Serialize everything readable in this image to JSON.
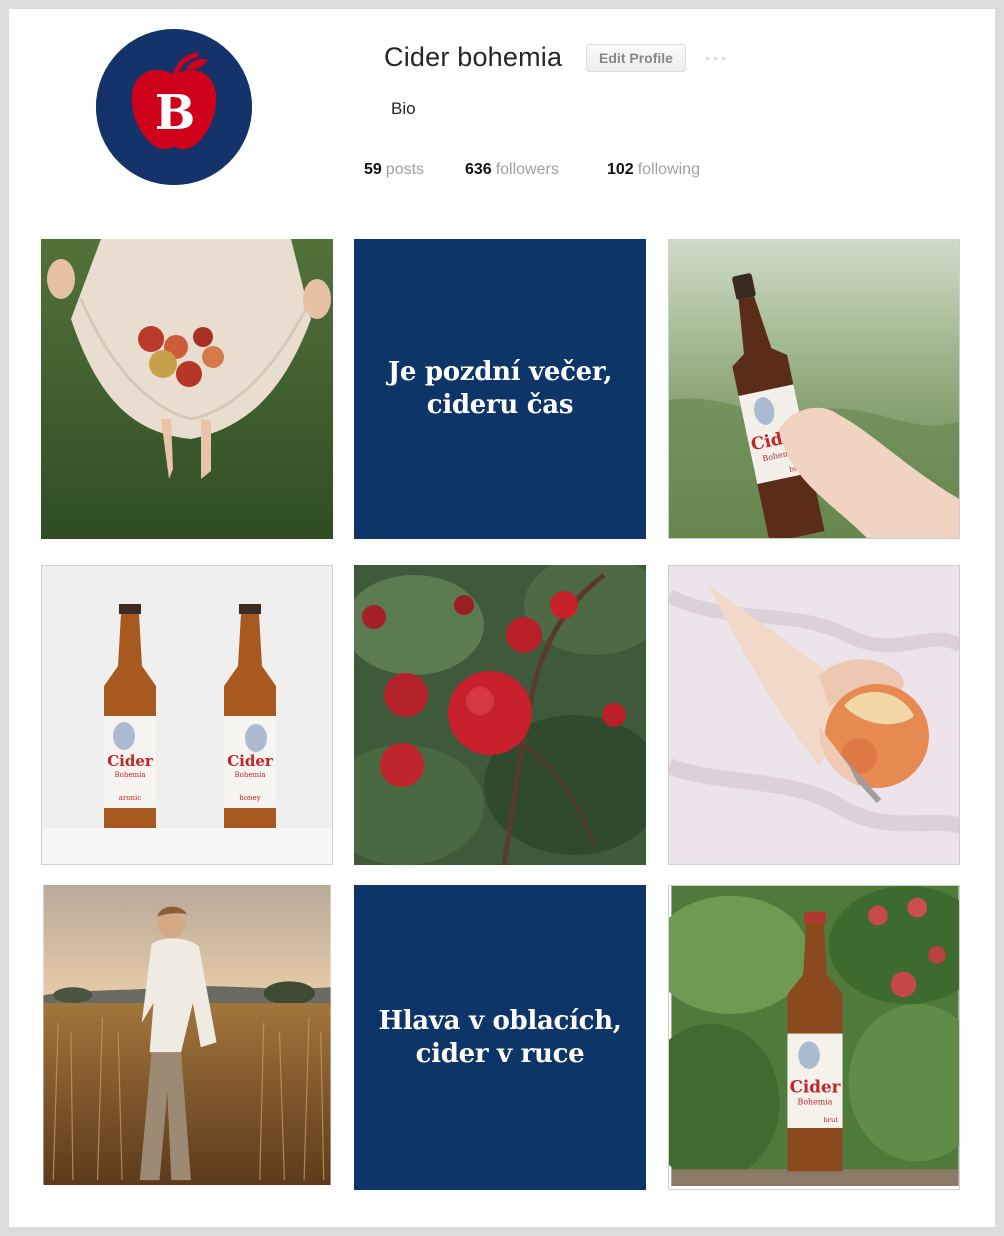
{
  "profile": {
    "username": "Cider bohemia",
    "edit_label": "Edit Profile",
    "bio": "Bio",
    "avatar_letter": "B",
    "brand_colors": {
      "navy": "#14336a",
      "red": "#d0021b"
    }
  },
  "stats": {
    "posts": {
      "count": "59",
      "label": "posts"
    },
    "followers": {
      "count": "636",
      "label": "followers"
    },
    "following": {
      "count": "102",
      "label": "following"
    }
  },
  "posts": {
    "text_post_1": "Je pozdní večer,\ncideru čas",
    "text_post_2": "Hlava v oblacích,\ncider v ruce",
    "bottle_brand": "Cider",
    "bottle_sub": "Bohemia",
    "flavor_brut": "brut",
    "flavor_aronic": "aronic",
    "flavor_honey": "honey"
  }
}
